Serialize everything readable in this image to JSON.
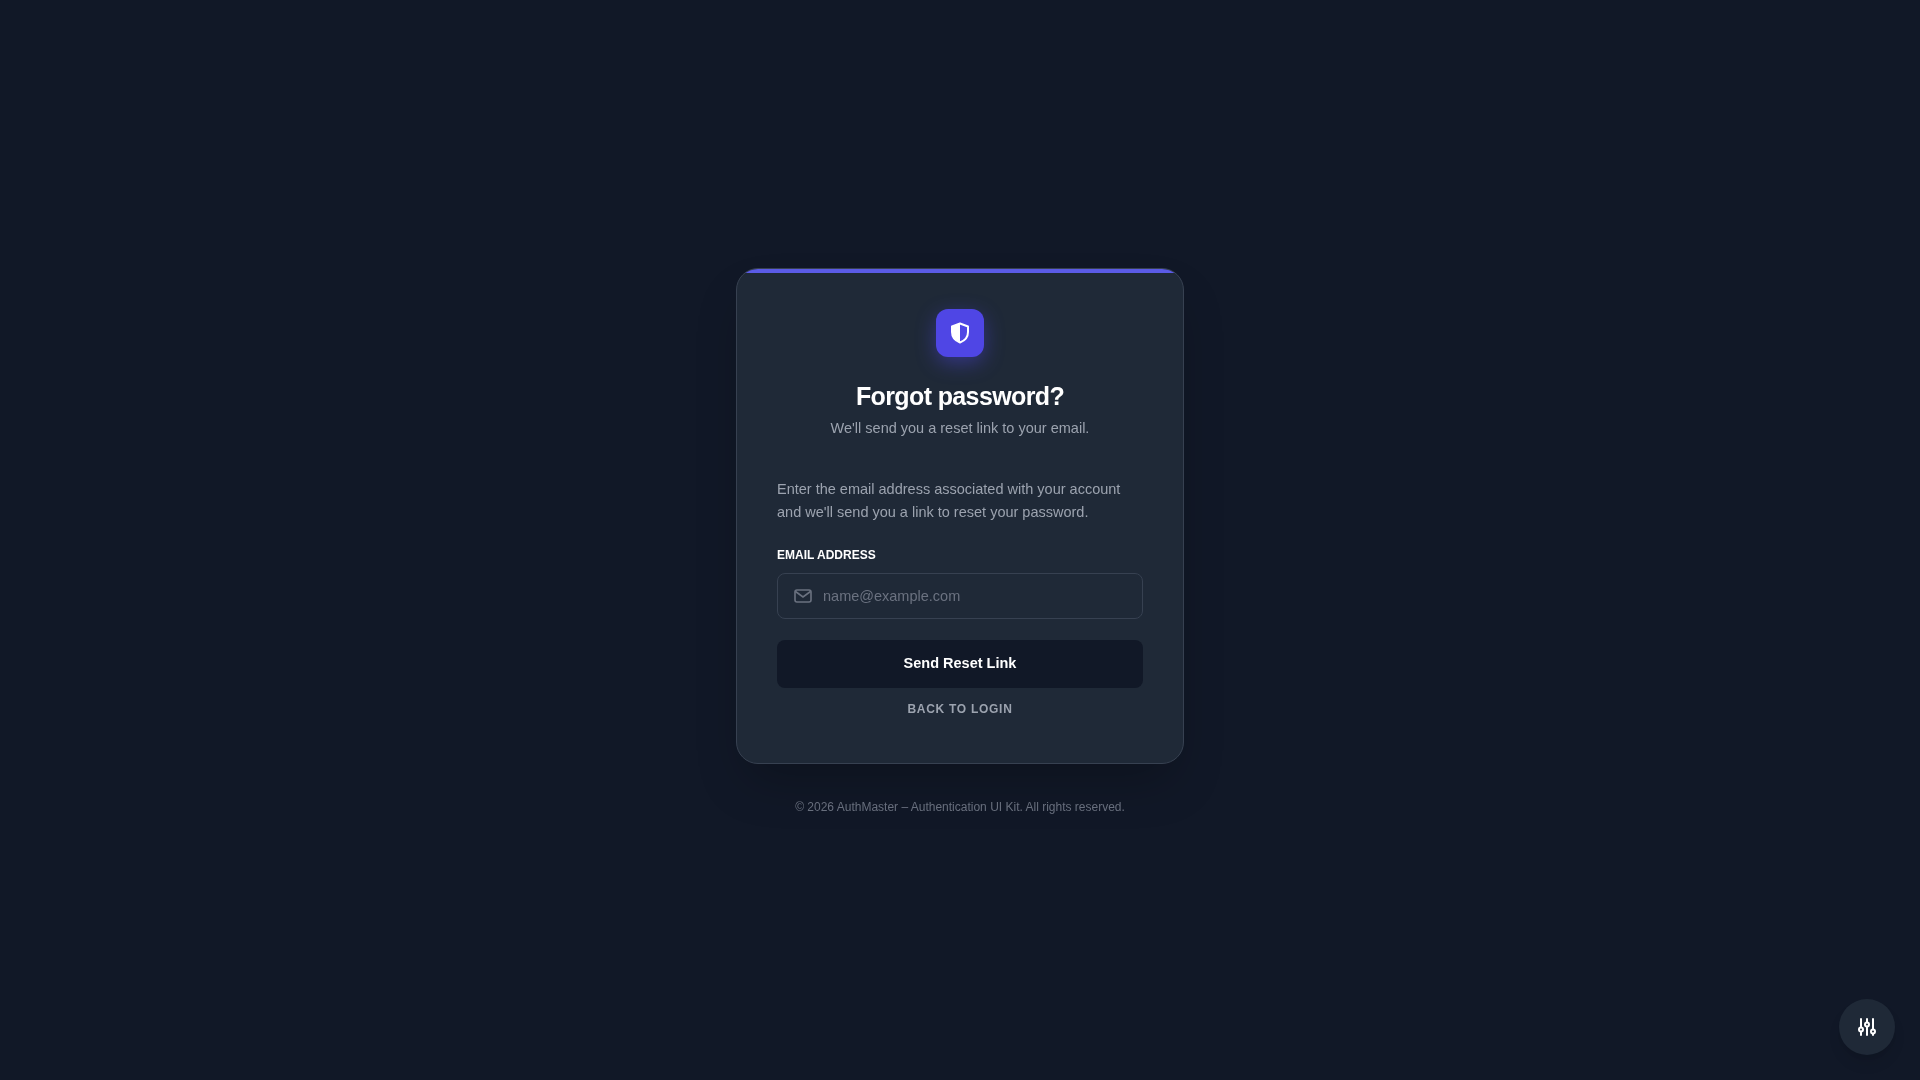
{
  "card": {
    "title": "Forgot password?",
    "subtitle": "We'll send you a reset link to your email.",
    "instructions": "Enter the email address associated with your account and we'll send you a link to reset your password.",
    "email_field": {
      "label": "EMAIL ADDRESS",
      "placeholder": "name@example.com"
    },
    "submit_button": "Send Reset Link",
    "back_link": "BACK TO LOGIN"
  },
  "footer": "© 2026 AuthMaster – Authentication UI Kit. All rights reserved."
}
